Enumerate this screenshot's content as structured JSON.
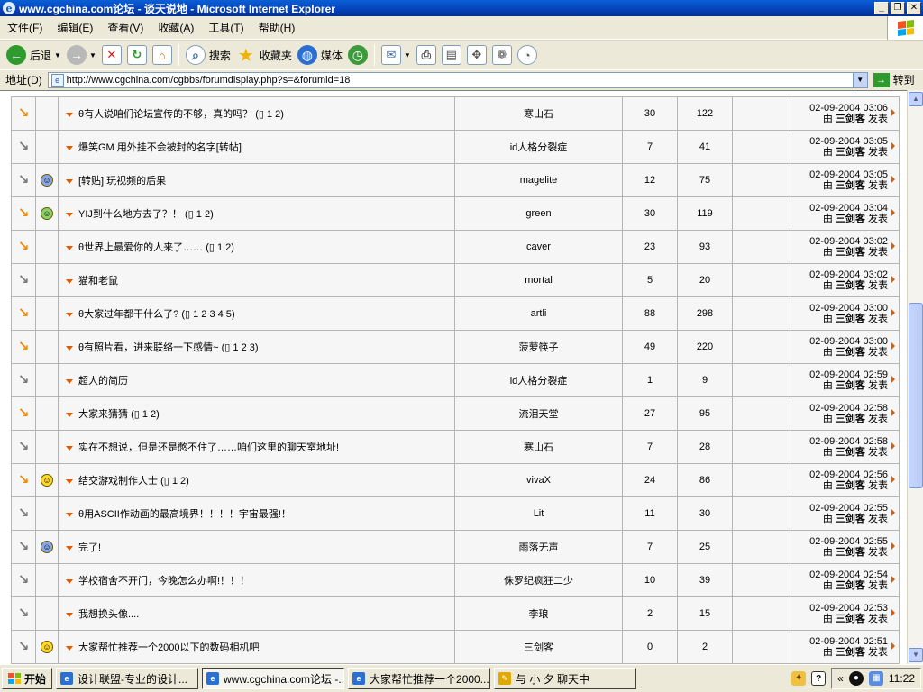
{
  "window": {
    "title": "www.cgchina.com论坛 - 谈天说地 - Microsoft Internet Explorer",
    "buttons": [
      "_",
      "❐",
      "✕"
    ]
  },
  "menubar": [
    "文件(F)",
    "编辑(E)",
    "查看(V)",
    "收藏(A)",
    "工具(T)",
    "帮助(H)"
  ],
  "toolbar": {
    "back": "后退",
    "search": "搜索",
    "favorites": "收藏夹",
    "media": "媒体"
  },
  "address": {
    "label": "地址(D)",
    "url": "http://www.cgchina.com/cgbbs/forumdisplay.php?s=&forumid=18",
    "go": "转到"
  },
  "threads": [
    {
      "status": "hot",
      "emoticon": "",
      "subject": "有人说咱们论坛宣传的不够，真的吗？",
      "poll": true,
      "pages": "1 2",
      "author": "寒山石",
      "replies": "30",
      "views": "122",
      "date": "02-09-2004 03:06",
      "by": "三剑客"
    },
    {
      "status": "cold",
      "emoticon": "",
      "subject": "爆笑GM 用外挂不会被封的名字[转帖]",
      "poll": false,
      "pages": "",
      "author": "id人格分裂症",
      "replies": "7",
      "views": "41",
      "date": "02-09-2004 03:05",
      "by": "三剑客"
    },
    {
      "status": "cold",
      "emoticon": "blue",
      "subject": "[转贴] 玩视频的后果",
      "poll": false,
      "pages": "",
      "author": "magelite",
      "replies": "12",
      "views": "75",
      "date": "02-09-2004 03:05",
      "by": "三剑客"
    },
    {
      "status": "hot",
      "emoticon": "green",
      "subject": "YIJ到什么地方去了？！",
      "poll": false,
      "pages": "1 2",
      "author": "green",
      "replies": "30",
      "views": "119",
      "date": "02-09-2004 03:04",
      "by": "三剑客"
    },
    {
      "status": "hot",
      "emoticon": "",
      "subject": "世界上最爱你的人来了……",
      "poll": true,
      "pages": "1 2",
      "author": "caver",
      "replies": "23",
      "views": "93",
      "date": "02-09-2004 03:02",
      "by": "三剑客"
    },
    {
      "status": "cold",
      "emoticon": "",
      "subject": "猫和老鼠",
      "poll": false,
      "pages": "",
      "author": "mortal",
      "replies": "5",
      "views": "20",
      "date": "02-09-2004 03:02",
      "by": "三剑客"
    },
    {
      "status": "hot",
      "emoticon": "",
      "subject": "大家过年都干什么了?",
      "poll": true,
      "pages": "1 2 3 4 5",
      "author": "artli",
      "replies": "88",
      "views": "298",
      "date": "02-09-2004 03:00",
      "by": "三剑客"
    },
    {
      "status": "hot",
      "emoticon": "",
      "subject": "有照片看，进来联络一下感情~",
      "poll": true,
      "pages": "1 2 3",
      "author": "菠萝筷子",
      "replies": "49",
      "views": "220",
      "date": "02-09-2004 03:00",
      "by": "三剑客"
    },
    {
      "status": "cold",
      "emoticon": "",
      "subject": "超人的简历",
      "poll": false,
      "pages": "",
      "author": "id人格分裂症",
      "replies": "1",
      "views": "9",
      "date": "02-09-2004 02:59",
      "by": "三剑客"
    },
    {
      "status": "hot",
      "emoticon": "",
      "subject": "大家来猜猜",
      "poll": false,
      "pages": "1 2",
      "author": "流泪天堂",
      "replies": "27",
      "views": "95",
      "date": "02-09-2004 02:58",
      "by": "三剑客"
    },
    {
      "status": "cold",
      "emoticon": "",
      "subject": "实在不想说，但是还是憋不住了……咱们这里的聊天室地址!",
      "poll": false,
      "pages": "",
      "author": "寒山石",
      "replies": "7",
      "views": "28",
      "date": "02-09-2004 02:58",
      "by": "三剑客"
    },
    {
      "status": "hot",
      "emoticon": "yellow",
      "subject": "结交游戏制作人士",
      "poll": false,
      "pages": "1 2",
      "author": "vivaX",
      "replies": "24",
      "views": "86",
      "date": "02-09-2004 02:56",
      "by": "三剑客"
    },
    {
      "status": "cold",
      "emoticon": "",
      "subject": "用ASCII作动画的最高境界！！！！宇宙最强!！",
      "poll": true,
      "pages": "",
      "author": "Lit",
      "replies": "11",
      "views": "30",
      "date": "02-09-2004 02:55",
      "by": "三剑客"
    },
    {
      "status": "cold",
      "emoticon": "blue",
      "subject": "完了!",
      "poll": false,
      "pages": "",
      "author": "雨落无声",
      "replies": "7",
      "views": "25",
      "date": "02-09-2004 02:55",
      "by": "三剑客"
    },
    {
      "status": "cold",
      "emoticon": "",
      "subject": "学校宿舍不开门，今晚怎么办啊!！！！",
      "poll": false,
      "pages": "",
      "author": "侏罗纪疯狂二少",
      "replies": "10",
      "views": "39",
      "date": "02-09-2004 02:54",
      "by": "三剑客"
    },
    {
      "status": "cold",
      "emoticon": "",
      "subject": "我想换头像....",
      "poll": false,
      "pages": "",
      "author": "李琅",
      "replies": "2",
      "views": "15",
      "date": "02-09-2004 02:53",
      "by": "三剑客"
    },
    {
      "status": "cold",
      "emoticon": "yellow",
      "subject": "大家帮忙推荐一个2000以下的数码相机吧",
      "poll": false,
      "pages": "",
      "author": "三剑客",
      "replies": "0",
      "views": "2",
      "date": "02-09-2004 02:51",
      "by": "三剑客"
    }
  ],
  "labels": {
    "by_prefix": "由",
    "by_suffix": "发表"
  },
  "taskbar": {
    "start": "开始",
    "tasks": [
      "设计联盟-专业的设计...",
      "www.cgchina.com论坛 -...",
      "大家帮忙推荐一个2000...",
      "与 小 夕 聊天中"
    ],
    "clock": "11:22",
    "tray_chevron": "«"
  },
  "colors": {
    "hot_arrow": "#f08a00",
    "cold_arrow": "#7a7a7a",
    "title_bar": "#0541b8"
  }
}
